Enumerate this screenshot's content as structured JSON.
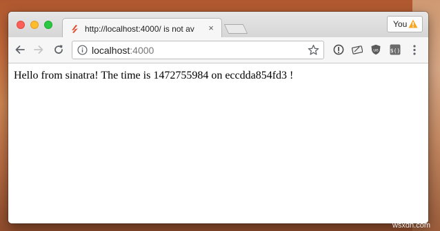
{
  "browser": {
    "tab": {
      "title": "http://localhost:4000/ is not av",
      "close_glyph": "×"
    },
    "profile": {
      "label": "You",
      "icon": "warning-icon"
    },
    "toolbar": {
      "url_host": "localhost",
      "url_port": ":4000",
      "icons": [
        "back-arrow-icon",
        "forward-arrow-icon",
        "reload-icon",
        "info-icon",
        "star-icon",
        "extension-info-icon",
        "extension-edit-icon",
        "ublock-icon",
        "extension-dollar-icon",
        "more-menu-icon"
      ]
    },
    "colors": {
      "traffic_close": "#fc5f57",
      "traffic_minimize": "#fdbc2e",
      "traffic_maximize": "#29c840",
      "favicon": "#e04b2d",
      "warning": "#f5a623"
    }
  },
  "page": {
    "text": "Hello from sinatra! The time is 1472755984 on eccdda854fd3 !"
  },
  "watermark": "wsxdn.com"
}
